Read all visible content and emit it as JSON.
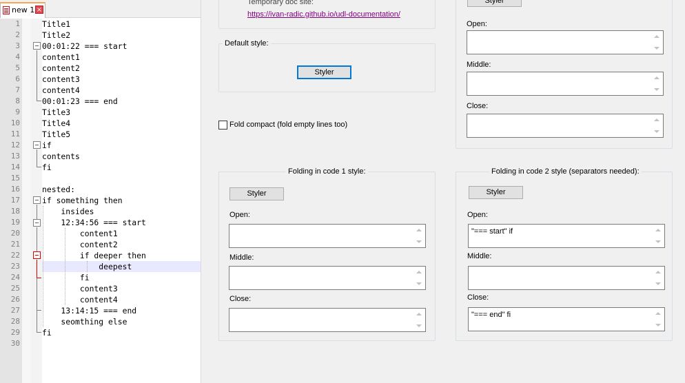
{
  "editor": {
    "tab": {
      "label": "new 1",
      "close": "×"
    },
    "lines": [
      "Title1",
      "Title2",
      "00:01:22 === start",
      "content1",
      "content2",
      "content3",
      "content4",
      "00:01:23 === end",
      "Title3",
      "Title4",
      "Title5",
      "if",
      "contents",
      "fi",
      "",
      "nested:",
      "if something then",
      "    insides",
      "    12:34:56 === start",
      "        content1",
      "        content2",
      "        if deeper then",
      "            deepest",
      "        fi",
      "        content3",
      "        content4",
      "    13:14:15 === end",
      "    seomthing else",
      "fi",
      ""
    ],
    "line_numbers": [
      "1",
      "2",
      "3",
      "4",
      "5",
      "6",
      "7",
      "8",
      "9",
      "10",
      "11",
      "12",
      "13",
      "14",
      "15",
      "16",
      "17",
      "18",
      "19",
      "20",
      "21",
      "22",
      "23",
      "24",
      "25",
      "26",
      "27",
      "28",
      "29",
      "30"
    ],
    "current_line": 23
  },
  "dialog": {
    "top_text": "Temporary doc site:",
    "doc_link": "https://ivan-radic.github.io/udl-documentation/",
    "default_style": {
      "title": "Default style:",
      "styler_label": "Styler"
    },
    "fold_compact": {
      "label": "Fold compact (fold empty lines too)",
      "checked": false
    },
    "comment_style": {
      "styler_label": "Styler",
      "open_label": "Open:",
      "open_value": "",
      "middle_label": "Middle:",
      "middle_value": "",
      "close_label": "Close:",
      "close_value": ""
    },
    "code1_style": {
      "title": "Folding in code 1 style:",
      "styler_label": "Styler",
      "open_label": "Open:",
      "open_value": "",
      "middle_label": "Middle:",
      "middle_value": "",
      "close_label": "Close:",
      "close_value": ""
    },
    "code2_style": {
      "title": "Folding in code 2 style (separators needed):",
      "styler_label": "Styler",
      "open_label": "Open:",
      "open_value": "\"=== start\" if",
      "middle_label": "Middle:",
      "middle_value": "",
      "close_label": "Close:",
      "close_value": "\"=== end\" fi"
    }
  },
  "colors": {
    "link": "#800080",
    "focus_border": "#0078d7",
    "current_line": "#e8e8ff",
    "fold_active": "#dd0000"
  }
}
